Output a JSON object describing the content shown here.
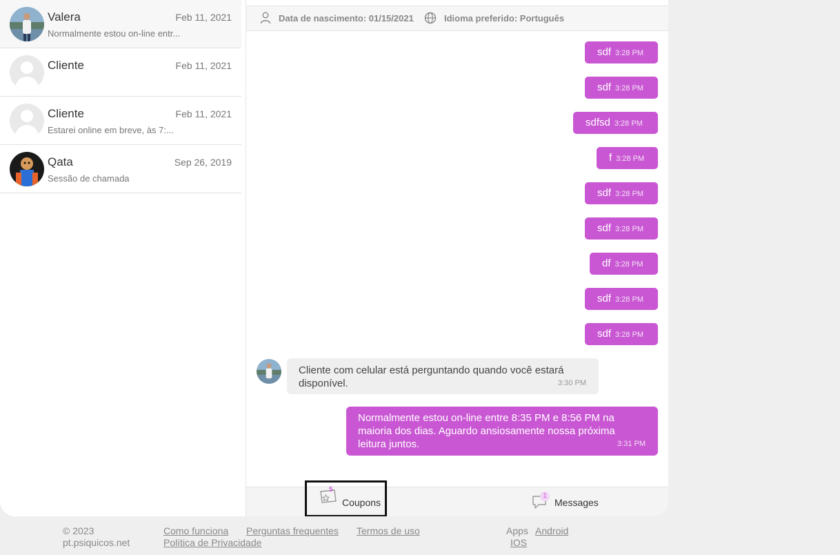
{
  "sidebar": {
    "conversations": [
      {
        "name": "Valera",
        "date": "Feb 11, 2021",
        "preview": "Normalmente estou on-line entr..."
      },
      {
        "name": "Cliente",
        "date": "Feb 11, 2021",
        "preview": ""
      },
      {
        "name": "Cliente",
        "date": "Feb 11, 2021",
        "preview": "Estarei online em breve, às 7:..."
      },
      {
        "name": "Qata",
        "date": "Sep 26, 2019",
        "preview": "Sessão de chamada"
      }
    ]
  },
  "info_bar": {
    "birth": "Data de nascimento: 01/15/2021",
    "language": "Idioma preferido: Português"
  },
  "messages": {
    "outgoing_short": [
      {
        "text": "sdf",
        "time": "3:28 PM"
      },
      {
        "text": "sdf",
        "time": "3:28 PM"
      },
      {
        "text": "sdfsd",
        "time": "3:28 PM"
      },
      {
        "text": "f",
        "time": "3:28 PM"
      },
      {
        "text": "sdf",
        "time": "3:28 PM"
      },
      {
        "text": "sdf",
        "time": "3:28 PM"
      },
      {
        "text": "df",
        "time": "3:28 PM"
      },
      {
        "text": "sdf",
        "time": "3:28 PM"
      },
      {
        "text": "sdf",
        "time": "3:28 PM"
      }
    ],
    "incoming": {
      "text": "Cliente com celular está perguntando quando você estará disponível.",
      "time": "3:30 PM"
    },
    "outgoing_long": {
      "text": "Normalmente estou on-line entre 8:35 PM e 8:56 PM na maioria dos dias. Aguardo ansiosamente nossa próxima leitura juntos.",
      "time": "3:31 PM"
    }
  },
  "bottom_bar": {
    "coupons_label": "Coupons",
    "coupons_count": "5",
    "messages_label": "Messages",
    "messages_count": "1"
  },
  "footer": {
    "copyright": "© 2023",
    "site": "pt.psiquicos.net",
    "how_it_works": "Como funciona",
    "faq": "Perguntas frequentes",
    "terms": "Termos de uso",
    "privacy": "Política de Privacidade",
    "apps_label": "Apps",
    "android": "Android",
    "ios": "IOS"
  },
  "colors": {
    "accent": "#c957d3",
    "background": "#efeff0"
  }
}
